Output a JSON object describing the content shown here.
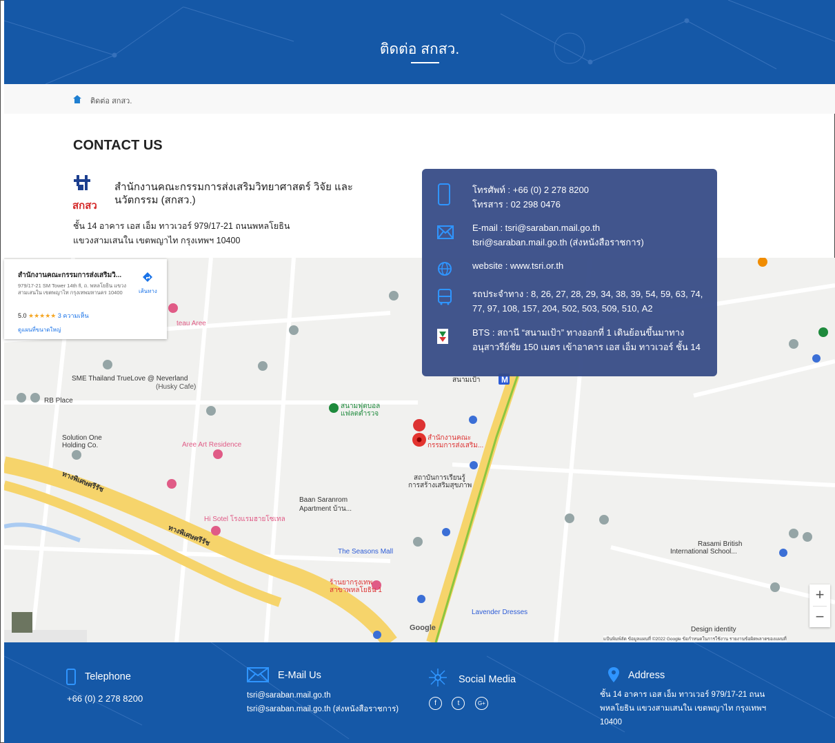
{
  "header": {
    "title": "ติดต่อ สกสว."
  },
  "breadcrumb": {
    "label": "ติดต่อ สกสว."
  },
  "contact": {
    "heading": "CONTACT US",
    "logo_text": "สกสว",
    "org_name": "สำนักงานคณะกรรมการส่งเสริมวิทยาศาสตร์ วิจัย และนวัตกรรม (สกสว.)",
    "address": "ชั้น 14 อาคาร เอส เอ็ม ทาวเวอร์ 979/17-21 ถนนพหลโยธิน แขวงสามเสนใน เขตพญาไท กรุงเทพฯ 10400"
  },
  "info_box": {
    "phone": "โทรศัพท์ : +66 (0) 2 278 8200",
    "fax": "โทรสาร : 02 298 0476",
    "email": "E-mail : tsri@saraban.mail.go.th",
    "email2": "tsri@saraban.mail.go.th (ส่งหนังสือราชการ)",
    "website": "website : www.tsri.or.th",
    "bus": "รถประจำทาง : 8, 26, 27, 28, 29, 34, 38, 39, 54, 59, 63, 74, 77, 97, 108, 157, 204, 502, 503, 509, 510, A2",
    "bts": "BTS : สถานี “สนามเป้า” ทางออกที่ 1 เดินย้อนขึ้นมาทาง อนุสาวรีย์ชัย 150 เมตร เข้าอาคาร เอส เอ็ม ทาวเวอร์ ชั้น 14"
  },
  "map": {
    "card": {
      "title": "สำนักงานคณะกรรมการส่งเสริมวิ...",
      "address": "979/17-21 SM Tower 14th fl, ถ. พหลโยธิน แขวง สามเสนใน เขตพญาไท กรุงเทพมหานคร 10400",
      "rating": "5.0",
      "stars": "★★★★★",
      "reviews": "3 ความเห็น",
      "larger_map": "ดูแผนที่ขนาดใหญ่",
      "directions": "เส้นทาง"
    },
    "labels": {
      "sme": "SME Thailand TrueLove @ Neverland",
      "husky": "(Husky Cafe)",
      "rb": "RB Place",
      "solution": "Solution One",
      "holding": "Holding Co.",
      "aree": "Aree Art Residence",
      "hisotel": "Hi Sotel โรงแรมฮายโซเทล",
      "baan": "Baan Saranrom",
      "apartment": "Apartment บ้าน...",
      "seasons": "The Seasons Mall",
      "lavender": "Lavender Dresses",
      "office": "สำนักงานคณะ",
      "office2": "กรรมการส่งเสริม...",
      "institute": "สถาบันการเรียนรู้",
      "institute2": "การสร้างเสริมสุขภาพ",
      "phahon": "ทางพิเศษศรีรัช",
      "phahon2": "ทางพิเศษศรีรัช",
      "football": "สนามฟุตบอล",
      "football2": "แฟลตตำรวจ",
      "rasami": "Rasami British",
      "school": "International School...",
      "design": "Design identity",
      "teau": "teau Aree",
      "pharmacy": "ร้านยากรุงเทพ",
      "pharmacy2": "สาขาพหลโยธิน 1",
      "bts_label": "สนามเป้า"
    },
    "google": "Google",
    "zoom_in": "+",
    "zoom_out": "−",
    "footer_text": "แป้นพิมพ์ลัด   ข้อมูลแผนที่ ©2022 Google   ข้อกำหนดในการใช้งาน   รายงานข้อผิดพลาดของแผนที่"
  },
  "footer": {
    "telephone_heading": "Telephone",
    "telephone": "+66 (0) 2 278 8200",
    "email_heading": "E-Mail Us",
    "email1": "tsri@saraban.mail.go.th",
    "email2": "tsri@saraban.mail.go.th (ส่งหนังสือราชการ)",
    "social_heading": "Social Media",
    "social_f": "f",
    "social_t": "t",
    "social_g": "G+",
    "address_heading": "Address",
    "address": "ชั้น 14 อาคาร เอส เอ็ม ทาวเวอร์ 979/17-21 ถนนพหลโยธิน แขวงสามเสนใน เขตพญาไท กรุงเทพฯ 10400"
  },
  "colors": {
    "brand_blue": "#1558a7",
    "info_box": "#354a86",
    "road_yellow": "#f6d46b",
    "bts_line": "#8cc63f"
  }
}
